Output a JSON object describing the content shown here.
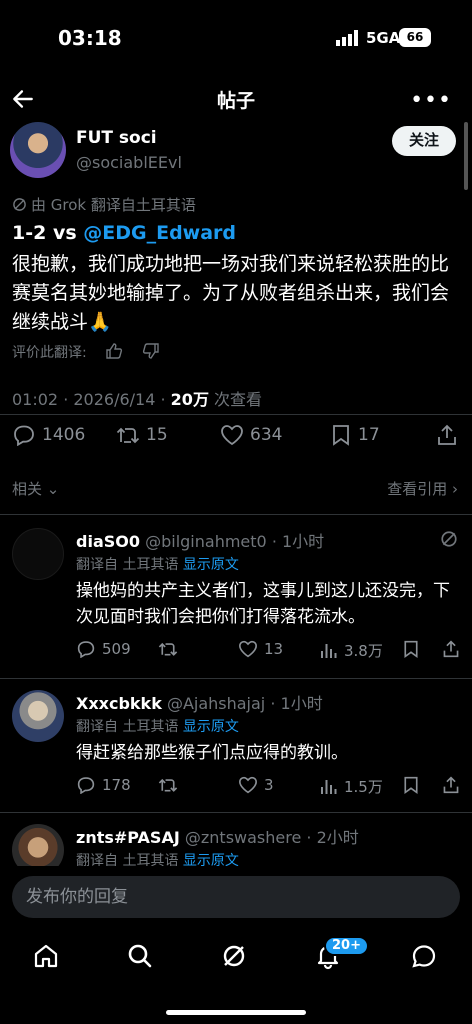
{
  "status_bar": {
    "time": "03:18",
    "network": "5GA",
    "battery": "66"
  },
  "header": {
    "title": "帖子"
  },
  "post": {
    "author_name": "FUT soci",
    "author_handle": "@sociablEEvl",
    "follow_label": "关注",
    "translated_note": "由 Grok 翻译自土耳其语",
    "line1_prefix": "1-2 vs ",
    "line1_mention": "@EDG_Edward",
    "body": "很抱歉，我们成功地把一场对我们来说轻松获胜的比赛莫名其妙地输掉了。为了从败者组杀出来，我们会继续战斗🙏",
    "rate_label": "评价此翻译:",
    "timestamp": "01:02 · 2026/6/14 · ",
    "views_count": "20万",
    "views_label": " 次查看",
    "replies": "1406",
    "reposts": "15",
    "likes": "634",
    "bookmarks": "17",
    "related_label": "相关",
    "quotes_label": "查看引用"
  },
  "replies": [
    {
      "name": "diaSO0",
      "handle": "@bilginahmet0",
      "time": "· 1小时",
      "translated": "翻译自 土耳其语",
      "show_original": "显示原文",
      "body": "操他妈的共产主义者们，这事儿到这儿还没完，下次见面时我们会把你们打得落花流水。",
      "replies": "509",
      "reposts": "",
      "likes": "13",
      "views": "3.8万"
    },
    {
      "name": "Xxxcbkkk",
      "handle": "@Ajahshajaj",
      "time": "· 1小时",
      "translated": "翻译自 土耳其语",
      "show_original": "显示原文",
      "body": "得赶紧给那些猴子们点应得的教训。",
      "replies": "178",
      "reposts": "",
      "likes": "3",
      "views": "1.5万"
    },
    {
      "name": "znts#PASAJ",
      "handle": "@zntswashere",
      "time": "· 2小时",
      "translated": "翻译自 土耳其语",
      "show_original": "显示原文"
    }
  ],
  "composer": {
    "placeholder": "发布你的回复"
  },
  "nav": {
    "notifications_badge": "20+"
  },
  "colors": {
    "accent": "#1d9bf0",
    "background": "#000000",
    "muted": "#71767b"
  }
}
